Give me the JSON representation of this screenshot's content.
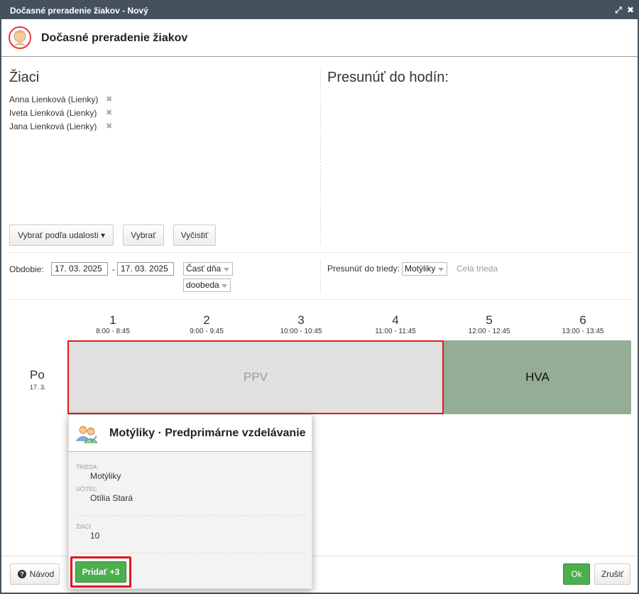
{
  "window": {
    "title": "Dočasné preradenie žiakov - Nový",
    "maximize_icon": "⤢",
    "close_icon": "✖"
  },
  "header": {
    "title": "Dočasné preradenie žiakov",
    "logo_icon": "student-transfer-icon"
  },
  "left_panel": {
    "title": "Žiaci",
    "students": [
      {
        "name": "Anna Lienková (Lienky)"
      },
      {
        "name": "Iveta Lienková (Lienky)"
      },
      {
        "name": "Jana Lienková (Lienky)"
      }
    ],
    "remove_icon": "✖",
    "buttons": {
      "select_by_event": "Vybrať podľa udalosti ▾",
      "select": "Vybrať",
      "clear": "Vyčistiť"
    }
  },
  "right_panel": {
    "title": "Presunúť do hodín:"
  },
  "filters": {
    "period_label": "Obdobie:",
    "date_from": "17. 03. 2025",
    "date_separator": "-",
    "date_to": "17. 03. 2025",
    "day_part_select": "Časť dňa",
    "morning_select": "doobeda",
    "move_to_class_label": "Presunúť do triedy:",
    "class_select": "Motýliky",
    "whole_class_link": "Celá trieda"
  },
  "schedule": {
    "periods": [
      {
        "num": "1",
        "time": "8:00 - 8:45"
      },
      {
        "num": "2",
        "time": "9:00 - 9:45"
      },
      {
        "num": "3",
        "time": "10:00 - 10:45"
      },
      {
        "num": "4",
        "time": "11:00 - 11:45"
      },
      {
        "num": "5",
        "time": "12:00 - 12:45"
      },
      {
        "num": "6",
        "time": "13:00 - 13:45"
      }
    ],
    "day": {
      "name": "Po",
      "date": "17. 3."
    },
    "blocks": [
      {
        "label": "PPV",
        "color": "#e0e0e0"
      },
      {
        "label": "HVA",
        "color": "#95ad95"
      }
    ]
  },
  "popup": {
    "title": "Motýliky · Predprimárne vzdelávanie",
    "icon": "group-icon",
    "class_label": "TRIEDA:",
    "class_value": "Motýliky",
    "teacher_label": "UČITEĽ:",
    "teacher_value": "Otília Stará",
    "students_label": "ŽIACI:",
    "students_value": "10",
    "add_button": "Pridať +3"
  },
  "footer": {
    "help_button": "Návod",
    "ok_button": "Ok",
    "cancel_button": "Zrušiť"
  },
  "colors": {
    "titlebar": "#45525e",
    "accent_green": "#4cae4c",
    "highlight_red": "#e0191d"
  }
}
